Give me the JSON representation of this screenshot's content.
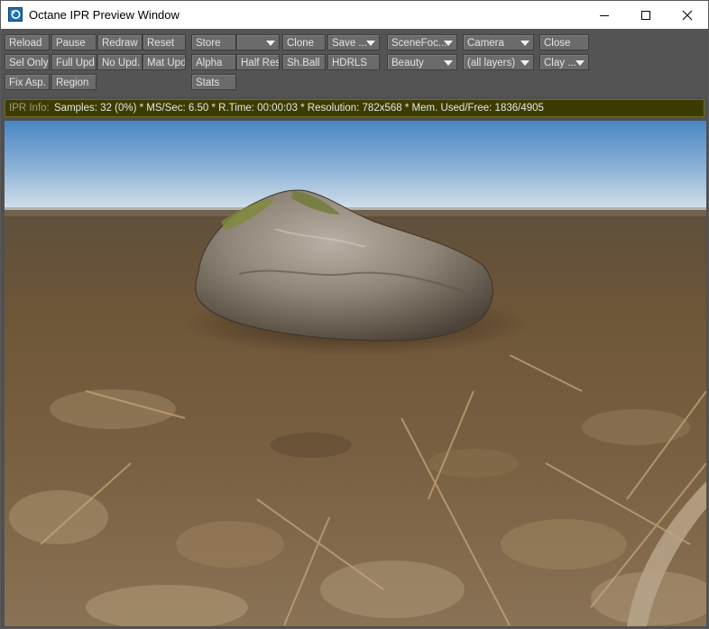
{
  "window": {
    "title": "Octane IPR Preview Window",
    "app_icon": "octane-app-icon",
    "controls": [
      "minimize-icon",
      "maximize-icon",
      "close-icon"
    ]
  },
  "toolbar": {
    "reload": "Reload",
    "pause": "Pause",
    "redraw": "Redraw",
    "reset": "Reset",
    "store": "Store",
    "store_slot": "",
    "clone": "Clone",
    "save": "Save ...",
    "scene_focus": "SceneFoc...",
    "camera": "Camera",
    "close": "Close",
    "sel_only": "Sel Only",
    "full_upd": "Full Upd.",
    "no_upd": "No Upd.",
    "mat_upd": "Mat Upd",
    "alpha": "Alpha",
    "half_res": "Half Res",
    "sh_ball": "Sh.Ball",
    "hdrls": "HDRLS",
    "render_pass": "Beauty",
    "layers": "(all layers)",
    "material_mode": "Clay ...",
    "fix_asp": "Fix Asp.",
    "region": "Region",
    "stats": "Stats"
  },
  "info": {
    "label": "IPR Info:",
    "text": "Samples: 32 (0%)  *  MS/Sec: 6.50  *  R.Time: 00:00:03  *  Resolution: 782x568  *  Mem. Used/Free: 1836/4905"
  },
  "colors": {
    "toolbar_bg": "#545454",
    "button_bg": "#6b6b6b",
    "infobar_bg": "#3d3c00",
    "sky_top": "#4a86c4",
    "sky_horizon": "#d6e2ea",
    "ground": "#6b5236"
  }
}
